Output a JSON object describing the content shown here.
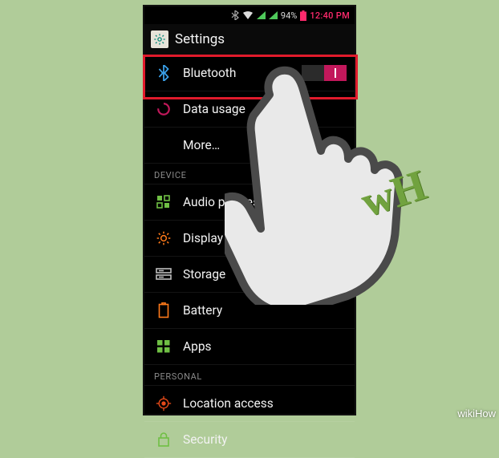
{
  "status": {
    "battery_pct": "94%",
    "clock": "12:40 PM"
  },
  "titlebar": {
    "title": "Settings"
  },
  "rows": {
    "bluetooth": "Bluetooth",
    "data_usage": "Data usage",
    "more": "More…",
    "audio_profiles": "Audio profiles",
    "display": "Display",
    "storage": "Storage",
    "battery": "Battery",
    "apps": "Apps",
    "location_access": "Location access",
    "security": "Security"
  },
  "sections": {
    "device": "DEVICE",
    "personal": "PERSONAL"
  },
  "toggle": {
    "bluetooth_on": true
  },
  "watermark": "wikiHow",
  "overlay_logo": "wH"
}
